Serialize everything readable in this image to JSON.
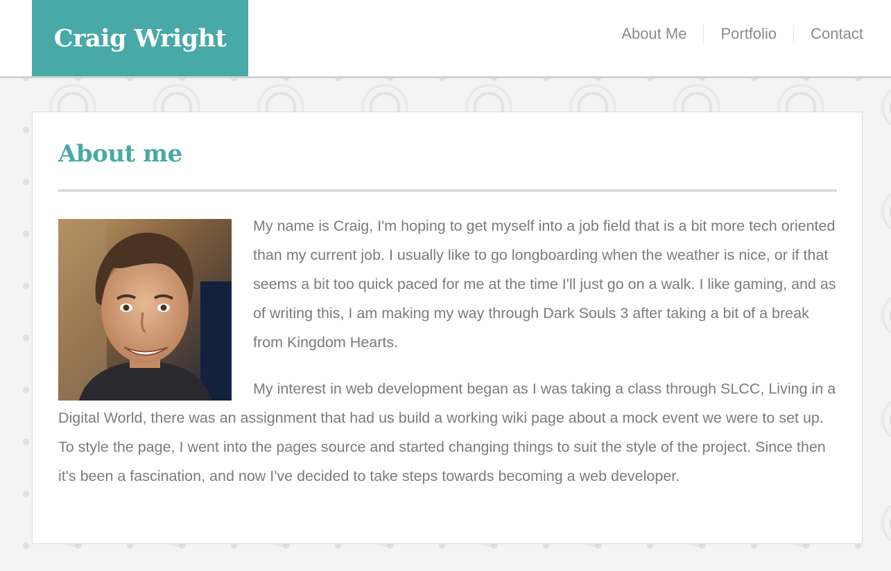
{
  "header": {
    "brand": "Craig Wright",
    "nav": [
      {
        "label": "About Me"
      },
      {
        "label": "Portfolio"
      },
      {
        "label": "Contact"
      }
    ]
  },
  "main": {
    "heading": "About me",
    "photo_alt": "Photo of Craig Wright",
    "paragraphs": [
      "My name is Craig, I'm hoping to get myself into a job field that is a bit more tech oriented than my current job. I usually like to go longboarding when the weather is nice, or if that seems a bit too quick paced for me at the time I'll just go on a walk. I like gaming, and as of writing this, I am making my way through Dark Souls 3 after taking a bit of a break from Kingdom Hearts.",
      "My interest in web development began as I was taking a class through SLCC, Living in a Digital World, there was an assignment that had us build a working wiki page about a mock event we were to set up. To style the page, I went into the pages source and started changing things to suit the style of the project. Since then it's been a fascination, and now I've decided to take steps towards becoming a web developer."
    ]
  },
  "colors": {
    "accent": "#48a9a6",
    "text": "#7b7b7b",
    "nav_text": "#8a8a8a",
    "background": "#f3f3f3"
  }
}
